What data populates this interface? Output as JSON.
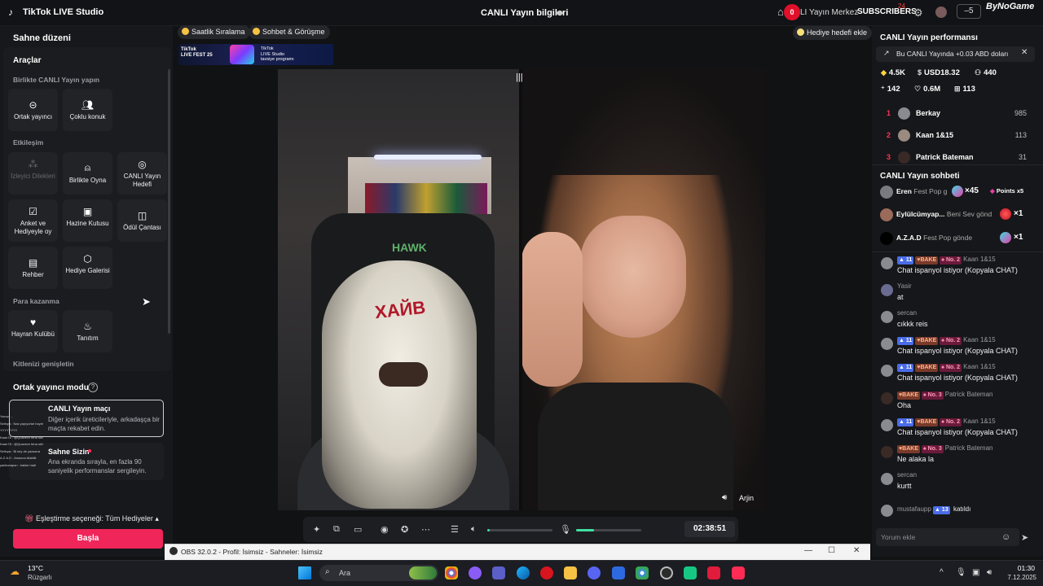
{
  "titlebar": {
    "app_title": "TikTok LIVE Studio",
    "stream_info": "CANLI Yayın bilgileri",
    "red_badge": "0",
    "center_link": "LI Yayın Merkez",
    "subs_label": "SUBSCRIBERS",
    "subs_count": "24",
    "minimize_box": "–5",
    "brand": "ByNoGame"
  },
  "left": {
    "scene_title": "Sahne düzeni",
    "tools_title": "Araçlar",
    "sections": {
      "together": "Birlikte CANLI Yayın yapın",
      "interaction": "Etkileşim",
      "monetization": "Para kazanma",
      "audience": "Kitlenizi genişletin"
    },
    "tools": {
      "cohost": "Ortak yayıncı",
      "multi_guest": "Çoklu konuk",
      "viewer_requests": "İzleyici Dilekleri",
      "play_together": "Birlikte Oyna",
      "live_goal": "CANLI Yayın Hedefi",
      "poll": "Anket ve Hediyeyle oy",
      "treasure_box": "Hazine Kutusu",
      "reward_bag": "Ödül Çantası",
      "guide": "Rehber",
      "gift_gallery": "Hediye Galerisi",
      "fan_club": "Hayran Kulübü",
      "promote": "Tanıtım"
    },
    "cohost_mode": "Ortak yayıncı modu",
    "cohost_help": "?",
    "match_title": "CANLI Yayın maçı",
    "match_desc": "Diğer içerik üreticileriyle, arkadaşça bir maçta rekabet edin.",
    "scene_card_title": "Sahne Sizin",
    "scene_card_desc": "Ana ekranda sırayla, en fazla 90 saniyelik performanslar sergileyin.",
    "mini_chat": [
      "Yavuz: ...",
      "Selinya : Naz yapıyorlar boyle",
      "YYYYYYYY",
      "Kaan78 : @Quavexx fena sik!",
      "Kaan78 : @Quavexx fena sik!",
      "Selinya : Bi sey de yazsana",
      "A.Z.A.D : Amazon Alabilir",
      "yarikonapsn : bakkk hadi"
    ],
    "match_pref": "Eşleştirme seçeneği: Tüm Hediyeler",
    "start_button": "Başla"
  },
  "center": {
    "pill_hourly": "Saatlik Sıralama",
    "pill_chat": "Sohbet & Görüşme",
    "pill_gift_goal": "Hediye hedefi ekle",
    "fest_left": [
      "TikTok",
      "LIVE FEST 25"
    ],
    "fest_right": [
      "TikTok",
      "LIVE Studio",
      "tavsiye programı"
    ],
    "mask_text": "ХАЙВ",
    "chair_logo": "HAWK",
    "guest_name": "Arjin",
    "timer": "02:38:51",
    "volume_level": 0.04,
    "mic_level": 0.28
  },
  "right": {
    "perf_title": "CANLI Yayın performansı",
    "perf_note": "Bu CANLI Yayında +0.03 ABD doları",
    "stats": {
      "diamonds": "4.5K",
      "usd": "USD18.32",
      "viewers": "440",
      "new_followers": "142",
      "likes": "0.6M",
      "gifters": "113"
    },
    "ranking": [
      {
        "rank": "1",
        "name": "Berkay",
        "score": "985"
      },
      {
        "rank": "2",
        "name": "Kaan 1&15",
        "score": "113"
      },
      {
        "rank": "3",
        "name": "Patrick Bateman",
        "score": "31"
      }
    ],
    "chat_title": "CANLI Yayın sohbeti",
    "pinned": [
      {
        "user": "Eren",
        "text": "Fest Pop g",
        "count": "×45",
        "extra": "Points x5"
      },
      {
        "user": "Eylülcümyap...",
        "text": "Beni Sev gönd",
        "count": "×1"
      },
      {
        "user": "A.Z.A.D",
        "text": "Fest Pop gönde",
        "count": "×1"
      }
    ],
    "messages": [
      {
        "user": "Kaan 1&15",
        "badges": [
          "11",
          "BAKE",
          "No. 2"
        ],
        "text": "Chat ispanyol istiyor (Kopyala CHAT)"
      },
      {
        "user": "Yasir",
        "badges": [],
        "text": "at"
      },
      {
        "user": "sercan",
        "badges": [],
        "text": "cıkkk reis"
      },
      {
        "user": "Kaan 1&15",
        "badges": [
          "11",
          "BAKE",
          "No. 2"
        ],
        "text": "Chat ispanyol istiyor (Kopyala CHAT)"
      },
      {
        "user": "Kaan 1&15",
        "badges": [
          "11",
          "BAKE",
          "No. 2"
        ],
        "text": "Chat ispanyol istiyor (Kopyala CHAT)"
      },
      {
        "user": "Patrick Bateman",
        "badges": [
          "BAKE",
          "No. 3"
        ],
        "text": "Oha"
      },
      {
        "user": "Kaan 1&15",
        "badges": [
          "11",
          "BAKE",
          "No. 2"
        ],
        "text": "Chat ispanyol istiyor (Kopyala CHAT)"
      },
      {
        "user": "Patrick Bateman",
        "badges": [
          "BAKE",
          "No. 3"
        ],
        "text": "Ne alaka la"
      },
      {
        "user": "sercan",
        "badges": [],
        "text": "kurtt"
      }
    ],
    "joined_user": "mustafaupp",
    "joined_level": "13",
    "joined_text": "katıldı",
    "comment_placeholder": "Yorum ekle"
  },
  "obs": {
    "title": "OBS 32.0.2 - Profil: İsimsiz - Sahneler: İsimsiz"
  },
  "taskbar": {
    "weather_temp": "13°C",
    "weather_desc": "Rüzgarlı",
    "search_placeholder": "Ara",
    "time": "01:30",
    "date": "7.12.2025"
  },
  "colors": {
    "accent": "#f0255a",
    "level_badge": "#4a6ce8",
    "meter": "#3fe0a0"
  }
}
